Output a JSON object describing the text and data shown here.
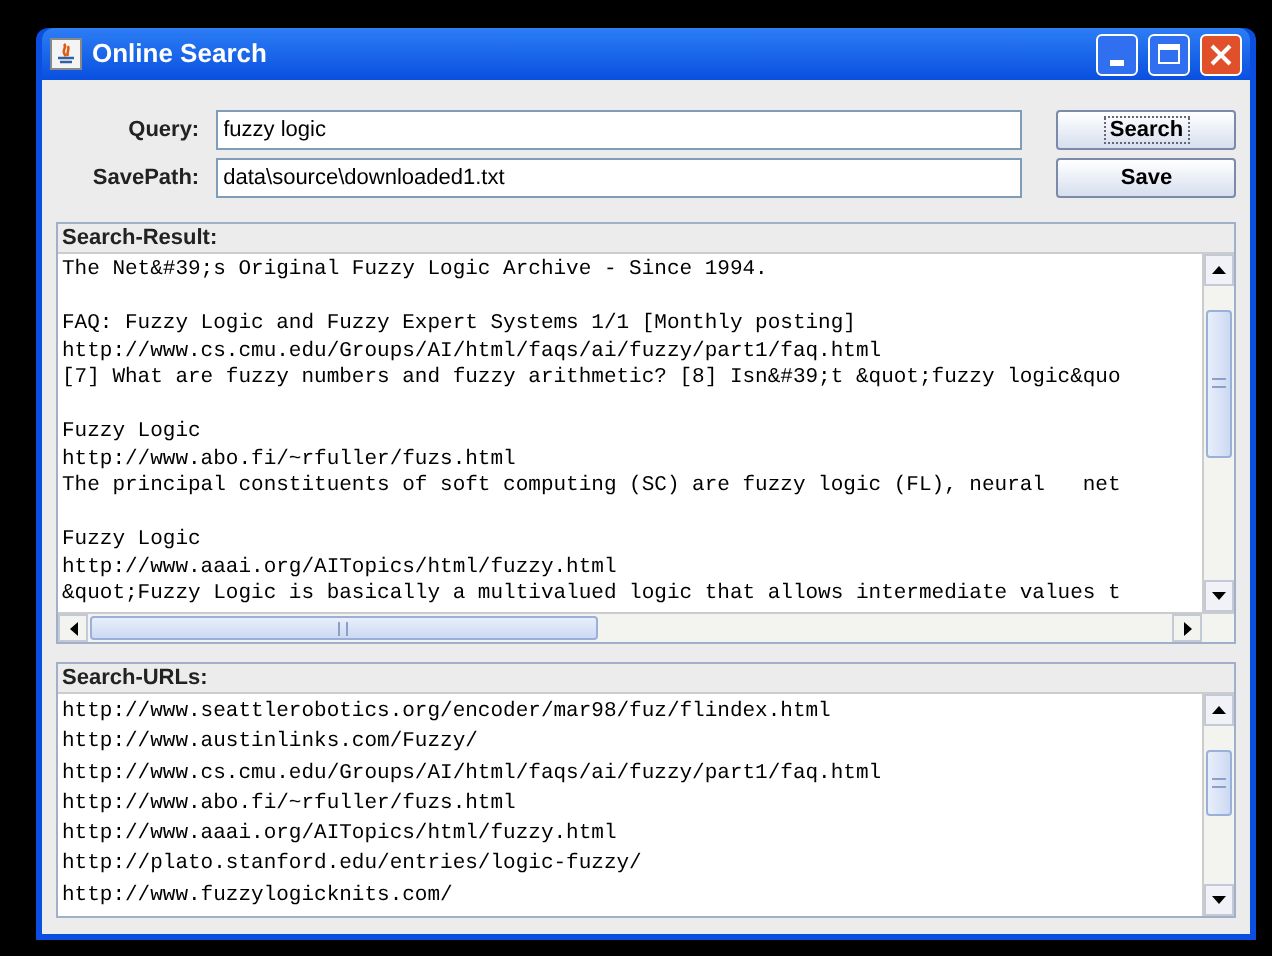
{
  "window": {
    "title": "Online Search"
  },
  "form": [
    {
      "label": "Query:",
      "value": "fuzzy logic",
      "button": "Search",
      "focused": true
    },
    {
      "label": "SavePath:",
      "value": "data\\source\\downloaded1.txt",
      "button": "Save",
      "focused": false
    }
  ],
  "search_result": {
    "title": "Search-Result:",
    "paragraphs": [
      [
        "The Net&#39;s Original Fuzzy Logic Archive - Since 1994."
      ],
      [
        "FAQ: Fuzzy Logic and Fuzzy Expert Systems 1/1 [Monthly posting]",
        "http://www.cs.cmu.edu/Groups/AI/html/faqs/ai/fuzzy/part1/faq.html",
        "[7] What are fuzzy numbers and fuzzy arithmetic? [8] Isn&#39;t &quot;fuzzy logic&quo"
      ],
      [
        "Fuzzy Logic",
        "http://www.abo.fi/~rfuller/fuzs.html",
        "The principal constituents of soft computing (SC) are fuzzy logic (FL), neural   net"
      ],
      [
        "Fuzzy Logic",
        "http://www.aaai.org/AITopics/html/fuzzy.html",
        "&quot;Fuzzy Logic is basically a multivalued logic that allows intermediate values t"
      ]
    ]
  },
  "search_urls": {
    "title": "Search-URLs:",
    "lines": [
      "http://www.seattlerobotics.org/encoder/mar98/fuz/flindex.html",
      "http://www.austinlinks.com/Fuzzy/",
      "http://www.cs.cmu.edu/Groups/AI/html/faqs/ai/fuzzy/part1/faq.html",
      "http://www.abo.fi/~rfuller/fuzs.html",
      "http://www.aaai.org/AITopics/html/fuzzy.html",
      "http://plato.stanford.edu/entries/logic-fuzzy/",
      "http://www.fuzzylogicknits.com/"
    ]
  }
}
